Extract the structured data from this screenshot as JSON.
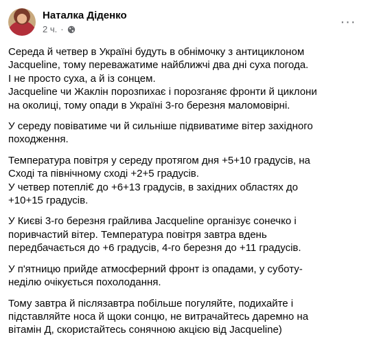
{
  "post": {
    "author": "Наталка Діденко",
    "time": "2 ч.",
    "separator": "·",
    "privacy_icon": "globe-icon",
    "more_icon": "more-options-icon",
    "more_label": "···",
    "paragraphs": [
      "Середа й четвер в Україні будуть в обнімочку з антициклоном\nJacqueline, тому переважатиме найближчі два дні суха погода.\nІ не просто суха, а й із сонцем.\nJacqueline чи Жаклін порозпихає і порозганяє фронти й циклони\nна околиці, тому опади в Україні 3-го березня маломовірні.",
      "У середу повіватиме чи й сильніше підвиватиме вітер західного\nпоходження.",
      "Температура повітря у середу протягом дня +5+10 градусів, на\nСході та північному сході +2+5 градусів.\nУ четвер потеплі€ до +6+13 градусів, в західних областях до\n+10+15 градусів.",
      "У Києві 3-го березня грайлива Jacqueline організує сонечко і\nпоривчастий вітер. Температура повітря завтра вдень\nпередбачається до +6 градусів, 4-го березня до +11 градусів.",
      "У п'ятницю прийде атмосферний фронт із опадами, у суботу-\nнеділю очікується похолодання.",
      "Тому завтра й післязавтра побільше погуляйте, подихайте і\nпідставляйте носа й щоки сонцю, не витрачайтесь даремно на\nвітамін Д, скористайтесь сонячною акцією від Jacqueline)"
    ]
  }
}
